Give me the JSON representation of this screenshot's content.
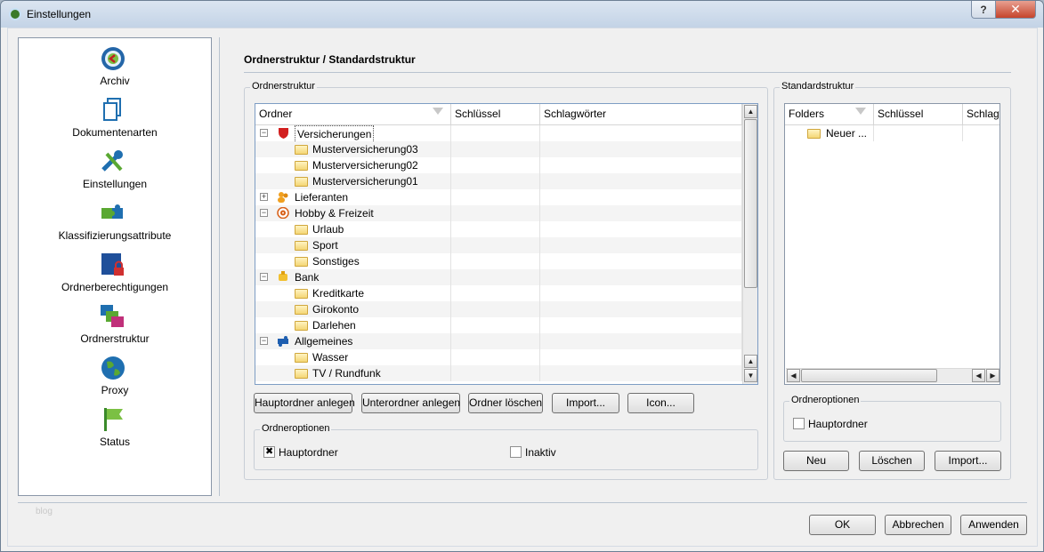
{
  "window": {
    "title": "Einstellungen",
    "help_label": "?",
    "close_label": "✕"
  },
  "sidebar": {
    "items": [
      {
        "label": "Archiv",
        "icon": "archive-icon"
      },
      {
        "label": "Dokumentenarten",
        "icon": "document-types-icon"
      },
      {
        "label": "Einstellungen",
        "icon": "settings-tools-icon"
      },
      {
        "label": "Klassifizierungsattribute",
        "icon": "puzzle-icon"
      },
      {
        "label": "Ordnerberechtigungen",
        "icon": "folder-lock-icon"
      },
      {
        "label": "Ordnerstruktur",
        "icon": "folder-structure-icon",
        "selected": true
      },
      {
        "label": "Proxy",
        "icon": "globe-icon"
      },
      {
        "label": "Status",
        "icon": "flag-icon"
      }
    ]
  },
  "page": {
    "title": "Ordnerstruktur / Standardstruktur"
  },
  "folder_structure": {
    "group_label": "Ordnerstruktur",
    "columns": [
      "Ordner",
      "Schlüssel",
      "Schlagwörter"
    ],
    "rows": [
      {
        "label": "Versicherungen",
        "level": 0,
        "expander": "−",
        "icon": "shield-icon",
        "selected": true
      },
      {
        "label": "Musterversicherung03",
        "level": 1,
        "icon": "folder-icon"
      },
      {
        "label": "Musterversicherung02",
        "level": 1,
        "icon": "folder-icon"
      },
      {
        "label": "Musterversicherung01",
        "level": 1,
        "icon": "folder-icon"
      },
      {
        "label": "Lieferanten",
        "level": 0,
        "expander": "+",
        "icon": "people-icon"
      },
      {
        "label": "Hobby & Freizeit",
        "level": 0,
        "expander": "−",
        "icon": "target-icon"
      },
      {
        "label": "Urlaub",
        "level": 1,
        "icon": "folder-icon"
      },
      {
        "label": "Sport",
        "level": 1,
        "icon": "folder-icon"
      },
      {
        "label": "Sonstiges",
        "level": 1,
        "icon": "folder-icon"
      },
      {
        "label": "Bank",
        "level": 0,
        "expander": "−",
        "icon": "money-icon"
      },
      {
        "label": "Kreditkarte",
        "level": 1,
        "icon": "folder-icon"
      },
      {
        "label": "Girokonto",
        "level": 1,
        "icon": "folder-icon"
      },
      {
        "label": "Darlehen",
        "level": 1,
        "icon": "folder-icon"
      },
      {
        "label": "Allgemeines",
        "level": 0,
        "expander": "−",
        "icon": "puzzle-blue-icon"
      },
      {
        "label": "Wasser",
        "level": 1,
        "icon": "folder-icon"
      },
      {
        "label": "TV / Rundfunk",
        "level": 1,
        "icon": "folder-icon"
      }
    ],
    "buttons": [
      "Hauptordner anlegen",
      "Unterordner anlegen",
      "Ordner löschen",
      "Import...",
      "Icon..."
    ],
    "options_label": "Ordneroptionen",
    "options": {
      "main_folder": {
        "label": "Hauptordner",
        "checked": true
      },
      "inactive": {
        "label": "Inaktiv",
        "checked": false
      }
    }
  },
  "standard_structure": {
    "group_label": "Standardstruktur",
    "columns": [
      "Folders",
      "Schlüssel",
      "Schlagw"
    ],
    "rows": [
      {
        "label": "Neuer ...",
        "icon": "folder-icon"
      }
    ],
    "options_label": "Ordneroptionen",
    "options": {
      "main_folder": {
        "label": "Hauptordner",
        "checked": false
      }
    },
    "buttons": {
      "new": "Neu",
      "delete": "Löschen",
      "import": "Import..."
    }
  },
  "footer": {
    "watermark": "blog",
    "ok": "OK",
    "cancel": "Abbrechen",
    "apply": "Anwenden"
  },
  "colors": {
    "selection_border": "#7e9dc4",
    "title_gradient_top": "#dbe5f1",
    "close_red": "#c5442c"
  }
}
